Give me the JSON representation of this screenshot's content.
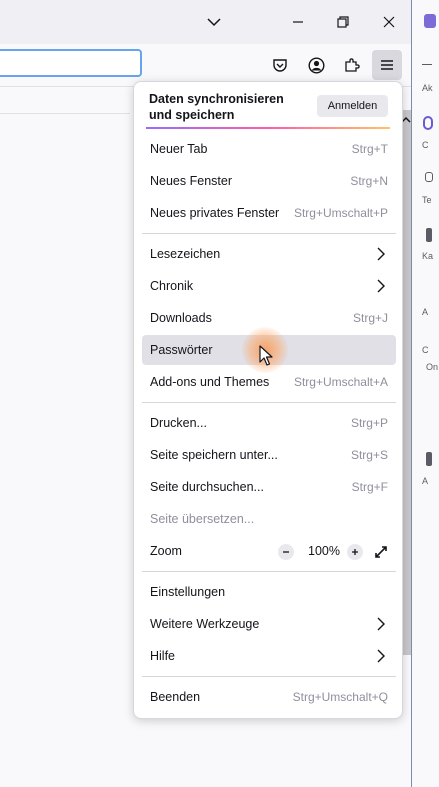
{
  "menu": {
    "sync": {
      "text": "Daten synchronisieren und speichern",
      "signin": "Anmelden"
    },
    "items": [
      {
        "label": "Neuer Tab",
        "shortcut": "Strg+T"
      },
      {
        "label": "Neues Fenster",
        "shortcut": "Strg+N"
      },
      {
        "label": "Neues privates Fenster",
        "shortcut": "Strg+Umschalt+P"
      },
      {
        "label": "Lesezeichen"
      },
      {
        "label": "Chronik"
      },
      {
        "label": "Downloads",
        "shortcut": "Strg+J"
      },
      {
        "label": "Passwörter"
      },
      {
        "label": "Add-ons und Themes",
        "shortcut": "Strg+Umschalt+A"
      },
      {
        "label": "Drucken...",
        "shortcut": "Strg+P"
      },
      {
        "label": "Seite speichern unter...",
        "shortcut": "Strg+S"
      },
      {
        "label": "Seite durchsuchen...",
        "shortcut": "Strg+F"
      },
      {
        "label": "Seite übersetzen..."
      },
      {
        "label": "Zoom",
        "zoom_value": "100%"
      },
      {
        "label": "Einstellungen"
      },
      {
        "label": "Weitere Werkzeuge"
      },
      {
        "label": "Hilfe"
      },
      {
        "label": "Beenden",
        "shortcut": "Strg+Umschalt+Q"
      }
    ]
  },
  "sidebar_fragments": [
    "Ak",
    "C",
    "Te",
    "Ka",
    "A",
    "C",
    "On",
    "A"
  ],
  "colors": {
    "accent": "#66a4ed",
    "hover": "#e0e0e6",
    "muted": "#8f8f9d"
  }
}
